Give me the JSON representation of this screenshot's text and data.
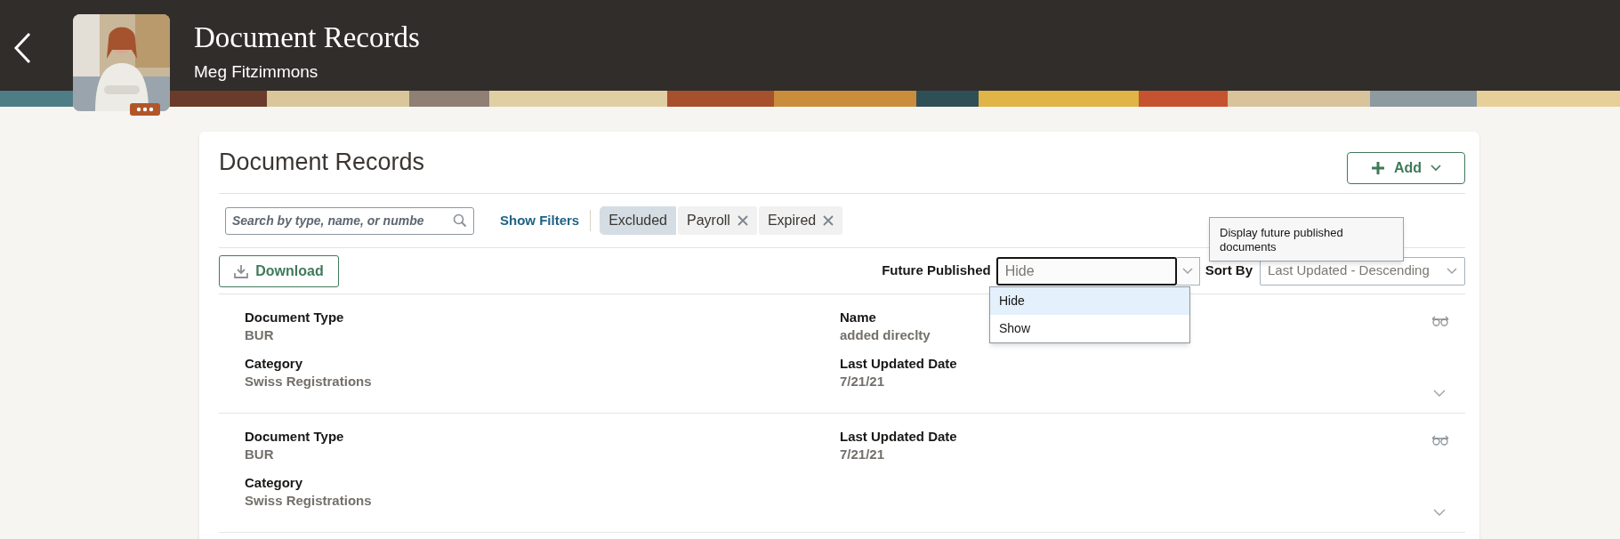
{
  "header": {
    "title": "Document Records",
    "subtitle": "Meg Fitzimmons"
  },
  "card": {
    "title": "Document Records",
    "add_button": "Add",
    "search": {
      "placeholder": "Search by type, name, or numbe"
    },
    "show_filters": "Show Filters",
    "chips": [
      {
        "label": "Excluded",
        "removable": false
      },
      {
        "label": "Payroll",
        "removable": true
      },
      {
        "label": "Expired",
        "removable": true
      }
    ],
    "download": "Download",
    "future_published": {
      "label": "Future Published",
      "value": "Hide",
      "options": [
        {
          "label": "Hide",
          "selected": true
        },
        {
          "label": "Show",
          "selected": false
        }
      ]
    },
    "sort_by": {
      "label": "Sort By",
      "value": "Last Updated - Descending"
    },
    "tooltip": "Display future published documents",
    "records": [
      {
        "left": [
          {
            "label": "Document Type",
            "value": "BUR"
          },
          {
            "label": "Category",
            "value": "Swiss Registrations"
          }
        ],
        "right": [
          {
            "label": "Name",
            "value": "added direclty"
          },
          {
            "label": "Last Updated Date",
            "value": "7/21/21"
          }
        ]
      },
      {
        "left": [
          {
            "label": "Document Type",
            "value": "BUR"
          },
          {
            "label": "Category",
            "value": "Swiss Registrations"
          }
        ],
        "right": [
          {
            "label": "Last Updated Date",
            "value": "7/21/21"
          }
        ]
      }
    ]
  }
}
